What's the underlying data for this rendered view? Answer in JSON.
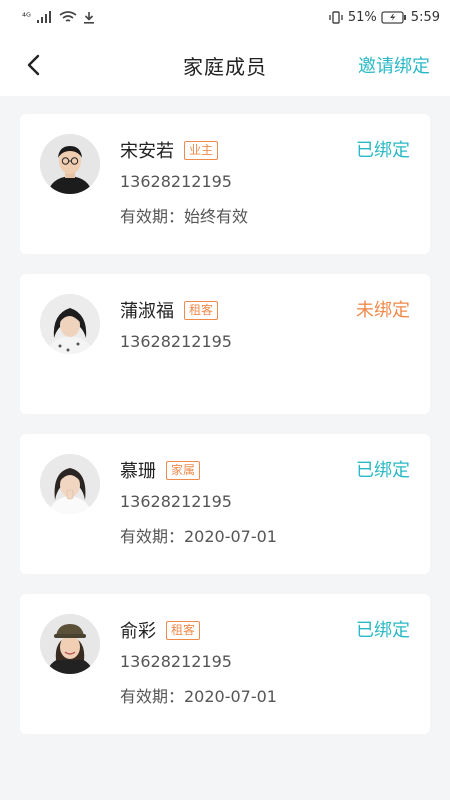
{
  "status_bar": {
    "network": "⁴ᴳ",
    "battery_percent": "51%",
    "time": "5:59"
  },
  "header": {
    "title": "家庭成员",
    "invite_label": "邀请绑定"
  },
  "colors": {
    "accent": "#29b9c6",
    "unbound": "#f08a4b",
    "tag": "#f08a4b"
  },
  "members": [
    {
      "name": "宋安若",
      "role": "业主",
      "phone": "13628212195",
      "status": "已绑定",
      "validity": "有效期：始终有效"
    },
    {
      "name": "蒲淑福",
      "role": "租客",
      "phone": "13628212195",
      "status": "未绑定",
      "validity": ""
    },
    {
      "name": "慕珊",
      "role": "家属",
      "phone": "13628212195",
      "status": "已绑定",
      "validity": "有效期：2020-07-01"
    },
    {
      "name": "俞彩",
      "role": "租客",
      "phone": "13628212195",
      "status": "已绑定",
      "validity": "有效期：2020-07-01"
    }
  ]
}
